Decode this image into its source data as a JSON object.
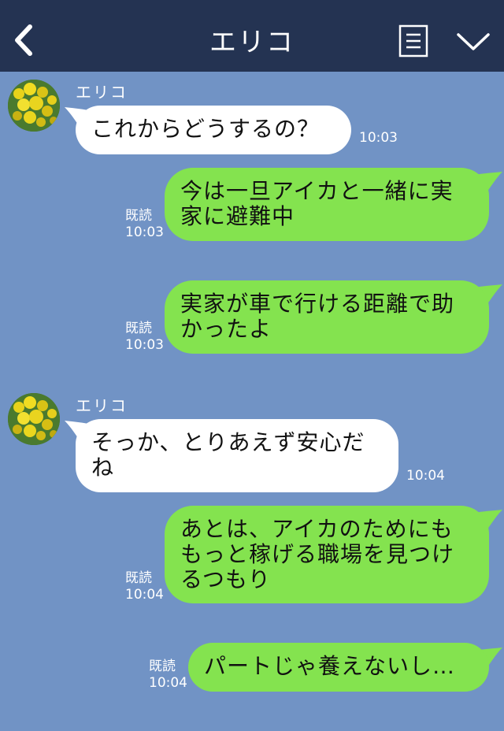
{
  "header": {
    "title": "エリコ"
  },
  "contact": {
    "name": "エリコ"
  },
  "messages": [
    {
      "dir": "in",
      "text": "これからどうするの？",
      "time": "10:03"
    },
    {
      "dir": "out",
      "text": "今は一旦アイカと一緒に実家に避難中",
      "read": "既読",
      "time": "10:03"
    },
    {
      "dir": "out",
      "text": "実家が車で行ける距離で助かったよ",
      "read": "既読",
      "time": "10:03"
    },
    {
      "dir": "in",
      "text": "そっか、とりあえず安心だね",
      "time": "10:04"
    },
    {
      "dir": "out",
      "text": "あとは、アイカのためにももっと稼げる職場を見つけるつもり",
      "read": "既読",
      "time": "10:04"
    },
    {
      "dir": "out",
      "text": "パートじゃ養えないし…",
      "read": "既読",
      "time": "10:04"
    }
  ],
  "colors": {
    "background": "#7193c5",
    "header": "#243352",
    "incoming_bubble": "#ffffff",
    "outgoing_bubble": "#84e34f"
  },
  "icons": {
    "back": "chevron-left-icon",
    "menu": "notes-icon",
    "collapse": "chevron-down-icon",
    "avatar": "mimosa-flower-avatar"
  }
}
